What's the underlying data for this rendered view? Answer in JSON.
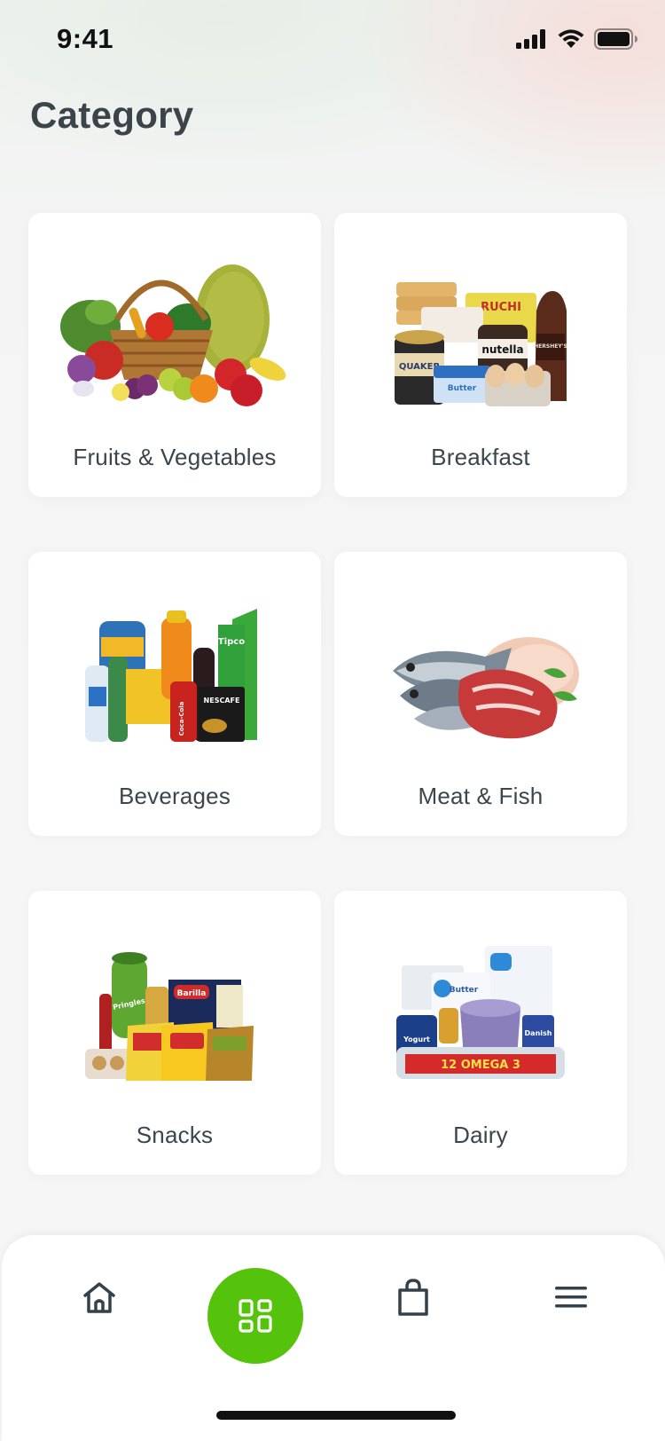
{
  "status_bar": {
    "time": "9:41"
  },
  "header": {
    "title": "Category"
  },
  "categories": [
    {
      "label": "Fruits & Vegetables",
      "image": "fruits-vegetables-basket"
    },
    {
      "label": "Breakfast",
      "image": "breakfast-products"
    },
    {
      "label": "Beverages",
      "image": "beverage-bottles"
    },
    {
      "label": "Meat & Fish",
      "image": "fish-and-meat"
    },
    {
      "label": "Snacks",
      "image": "snack-packs"
    },
    {
      "label": "Dairy",
      "image": "dairy-products"
    }
  ],
  "product_text": {
    "ruchi": "RUCHI",
    "nutella": "nutella",
    "hersheys": "HERSHEY'S",
    "quaker": "QUAKER",
    "butter": "Butter",
    "tipco": "Tipco",
    "nescafe": "NESCAFE",
    "coca_cola": "Coca-Cola",
    "pringles": "Pringles",
    "barilla": "Barilla",
    "omega": "12 OMEGA 3",
    "yogurt": "Yogurt",
    "danish": "Danish"
  },
  "bottom_nav": {
    "items": [
      {
        "name": "Home",
        "icon": "home-icon"
      },
      {
        "name": "Category",
        "icon": "grid-icon",
        "active": true
      },
      {
        "name": "Cart",
        "icon": "shopping-bag-icon"
      },
      {
        "name": "Menu",
        "icon": "menu-icon"
      }
    ]
  },
  "colors": {
    "accent": "#55c30c",
    "text": "#3a464d",
    "card": "#ffffff",
    "background": "#f6f6f6"
  }
}
